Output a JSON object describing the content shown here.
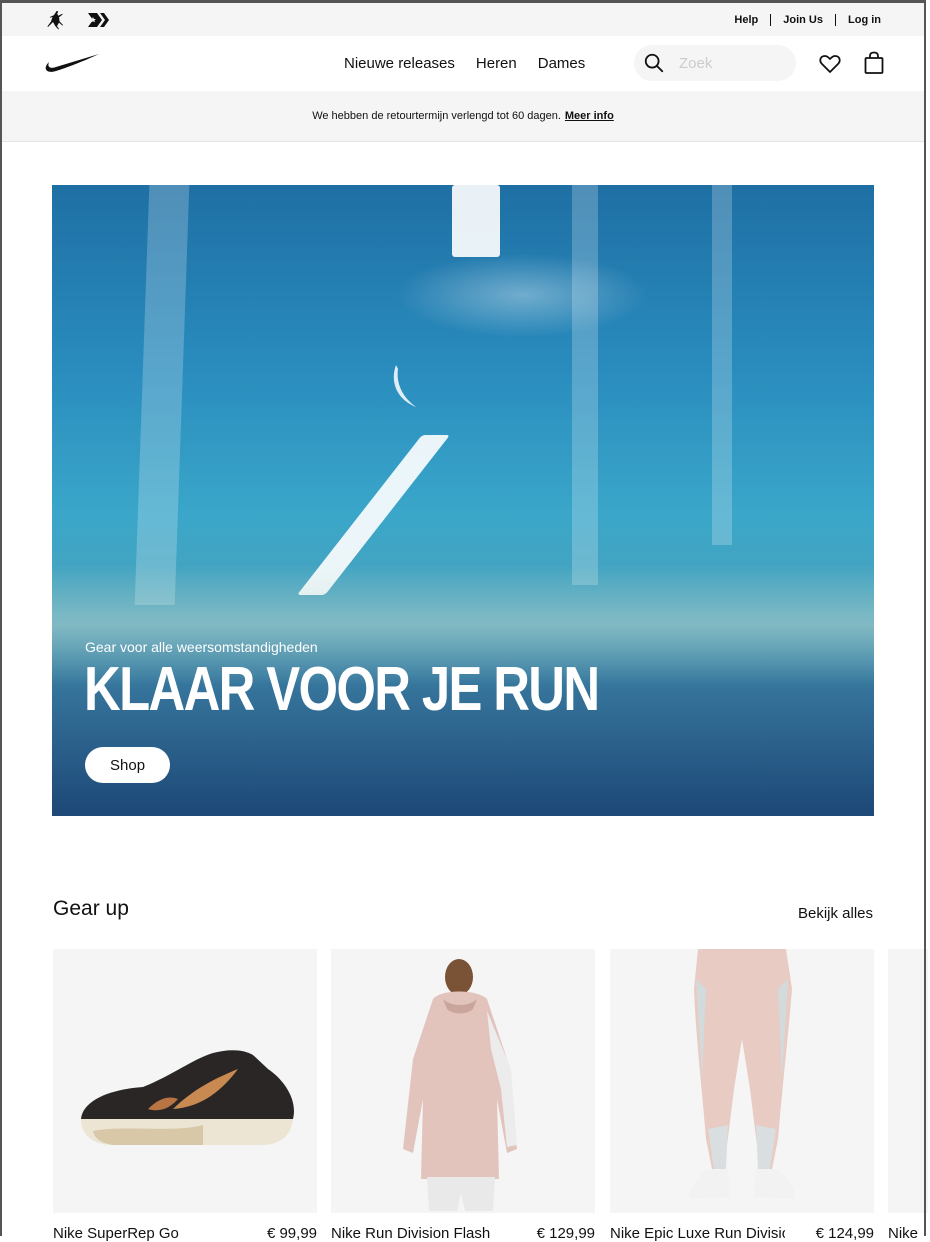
{
  "topbar": {
    "brands": [
      "jordan-icon",
      "converse-icon"
    ],
    "links": [
      "Help",
      "Join Us",
      "Log in"
    ]
  },
  "nav": {
    "logo": "nike-swoosh-icon",
    "menu": [
      "Nieuwe releases",
      "Heren",
      "Dames"
    ],
    "search_placeholder": "Zoek"
  },
  "promo": {
    "text": "We hebben de retourtermijn verlengd tot 60 dagen.",
    "link": "Meer info"
  },
  "hero": {
    "subtitle": "Gear voor alle weersomstandigheden",
    "title": "KLAAR VOOR JE RUN",
    "button": "Shop"
  },
  "gear": {
    "title": "Gear up",
    "view_all": "Bekijk alles",
    "products": [
      {
        "name": "Nike SuperRep Go",
        "price": "€ 99,99"
      },
      {
        "name": "Nike Run Division Flash",
        "price": "€ 129,99"
      },
      {
        "name": "Nike Epic Luxe Run Division",
        "price": "€ 124,99"
      },
      {
        "name": "Nike"
      }
    ]
  },
  "colors": {
    "accent": "#111111",
    "banner_bg": "#f5f5f5"
  }
}
